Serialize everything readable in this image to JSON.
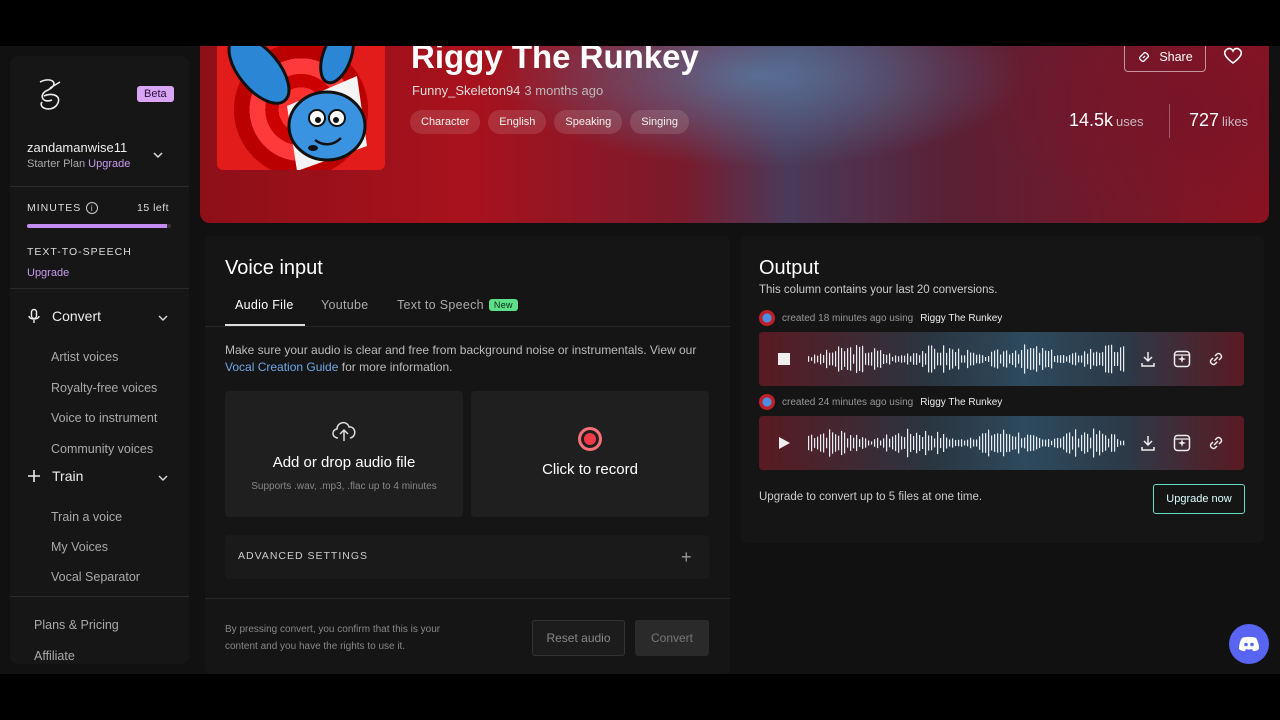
{
  "sidebar": {
    "beta": "Beta",
    "username": "zandamanwise11",
    "plan": "Starter Plan",
    "plan_upgrade": "Upgrade",
    "minutes_label": "MINUTES",
    "minutes_left": "15 left",
    "minutes_progress": 0.97,
    "tts_label": "TEXT-TO-SPEECH",
    "tts_upgrade": "Upgrade",
    "convert": {
      "label": "Convert",
      "items": [
        "Artist voices",
        "Royalty-free voices",
        "Voice to instrument",
        "Community voices"
      ]
    },
    "train": {
      "label": "Train",
      "items": [
        "Train a voice",
        "My Voices",
        "Vocal Separator"
      ]
    },
    "footer": [
      "Plans & Pricing",
      "Affiliate"
    ]
  },
  "banner": {
    "title": "Riggy The Runkey",
    "author": "Funny_Skeleton94",
    "ago": "3 months ago",
    "tags": [
      "Character",
      "English",
      "Speaking",
      "Singing"
    ],
    "share": "Share",
    "uses_value": "14.5k",
    "uses_unit": "uses",
    "likes_value": "727",
    "likes_unit": "likes"
  },
  "input": {
    "title": "Voice input",
    "tabs": [
      "Audio File",
      "Youtube",
      "Text to Speech"
    ],
    "new_badge": "New",
    "hint_pre": "Make sure your audio is clear and free from background noise or instrumentals. View our",
    "hint_link": "Vocal Creation Guide",
    "hint_post": "for more information.",
    "upload_title": "Add or drop audio file",
    "upload_sub": "Supports .wav, .mp3, .flac up to 4 minutes",
    "record_title": "Click to record",
    "advanced": "ADVANCED SETTINGS",
    "consent": "By pressing convert, you confirm that this is your content and you have the rights to use it.",
    "reset": "Reset audio",
    "convert": "Convert"
  },
  "output": {
    "title": "Output",
    "subtitle": "This column contains your last 20 conversions.",
    "conversions": [
      {
        "meta": "created 18 minutes ago using",
        "voice": "Riggy The Runkey",
        "state": "stop"
      },
      {
        "meta": "created 24 minutes ago using",
        "voice": "Riggy The Runkey",
        "state": "play"
      }
    ],
    "upgrade_note": "Upgrade to convert up to 5 files at one time.",
    "upgrade_btn": "Upgrade now"
  },
  "colors": {
    "accent": "#c79bf0",
    "new_badge": "#5ee08a",
    "record": "#f03a48",
    "discord": "#5865f2"
  }
}
